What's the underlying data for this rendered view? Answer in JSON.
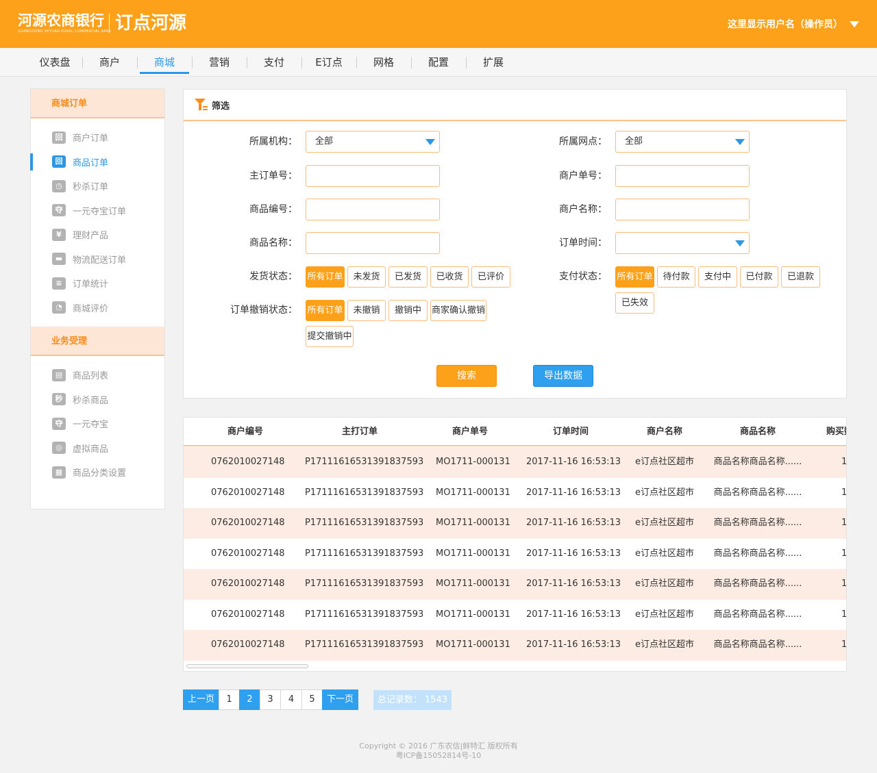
{
  "header": {
    "logo_main": "河源农商银行",
    "logo_sub": "GUANGDONG HEYUAN RURAL COMMERCIAL BANK",
    "app_name": "订点河源",
    "user_label": "这里显示用户名（操作员）"
  },
  "nav": [
    "仪表盘",
    "商户",
    "商城",
    "营销",
    "支付",
    "E订点",
    "网格",
    "配置",
    "扩展"
  ],
  "sidebar": {
    "group1_title": "商城订单",
    "group1_items": [
      {
        "label": "商户订单",
        "icon": "回"
      },
      {
        "label": "商品订单",
        "icon": "回"
      },
      {
        "label": "秒杀订单",
        "icon": "◷"
      },
      {
        "label": "一元夺宝订单",
        "icon": "夺"
      },
      {
        "label": "理财产品",
        "icon": "¥"
      },
      {
        "label": "物流配送订单",
        "icon": "▬"
      },
      {
        "label": "订单统计",
        "icon": "≡"
      },
      {
        "label": "商城评价",
        "icon": "◔"
      }
    ],
    "group2_title": "业务受理",
    "group2_items": [
      {
        "label": "商品列表",
        "icon": "▤"
      },
      {
        "label": "秒杀商品",
        "icon": "秒"
      },
      {
        "label": "一元夺宝",
        "icon": "夺"
      },
      {
        "label": "虚拟商品",
        "icon": "◎"
      },
      {
        "label": "商品分类设置",
        "icon": "▦"
      }
    ]
  },
  "filter": {
    "title": "筛选",
    "org_label": "所属机构：",
    "org_value": "全部",
    "branch_label": "所属网点：",
    "branch_value": "全部",
    "main_order_label": "主订单号：",
    "merchant_order_label": "商户单号：",
    "product_code_label": "商品编号：",
    "merchant_name_label": "商户名称：",
    "product_name_label": "商品名称：",
    "order_time_label": "订单时间：",
    "ship_label": "发货状态：",
    "ship_options": [
      "所有订单",
      "未发货",
      "已发货",
      "已收货",
      "已评价"
    ],
    "pay_label": "支付状态：",
    "pay_options": [
      "所有订单",
      "待付款",
      "支付中",
      "已付款",
      "已退款",
      "已失效"
    ],
    "cancel_label": "订单撤销状态：",
    "cancel_options": [
      "所有订单",
      "未撤销",
      "撤销中",
      "商家确认撤销",
      "提交撤销中"
    ],
    "search_button": "搜索",
    "export_button": "导出数据"
  },
  "table": {
    "columns": [
      "商户编号",
      "主打订单",
      "商户单号",
      "订单时间",
      "商户名称",
      "商品名称",
      "购买数"
    ],
    "rows": [
      [
        "0762010027148",
        "P17111616531391837593",
        "MO1711-000131",
        "2017-11-16 16:53:13",
        "e订点社区超市",
        "商品名称商品名称......",
        "1"
      ],
      [
        "0762010027148",
        "P17111616531391837593",
        "MO1711-000131",
        "2017-11-16 16:53:13",
        "e订点社区超市",
        "商品名称商品名称......",
        "1"
      ],
      [
        "0762010027148",
        "P17111616531391837593",
        "MO1711-000131",
        "2017-11-16 16:53:13",
        "e订点社区超市",
        "商品名称商品名称......",
        "1"
      ],
      [
        "0762010027148",
        "P17111616531391837593",
        "MO1711-000131",
        "2017-11-16 16:53:13",
        "e订点社区超市",
        "商品名称商品名称......",
        "1"
      ],
      [
        "0762010027148",
        "P17111616531391837593",
        "MO1711-000131",
        "2017-11-16 16:53:13",
        "e订点社区超市",
        "商品名称商品名称......",
        "1"
      ],
      [
        "0762010027148",
        "P17111616531391837593",
        "MO1711-000131",
        "2017-11-16 16:53:13",
        "e订点社区超市",
        "商品名称商品名称......",
        "1"
      ],
      [
        "0762010027148",
        "P17111616531391837593",
        "MO1711-000131",
        "2017-11-16 16:53:13",
        "e订点社区超市",
        "商品名称商品名称......",
        "1"
      ]
    ]
  },
  "pagination": {
    "prev": "上一页",
    "pages": [
      "1",
      "2",
      "3",
      "4",
      "5"
    ],
    "next": "下一页",
    "total": "总记录数： 1543"
  },
  "footer": {
    "line1": "Copyright © 2016 广东农信|鲜特汇 版权所有",
    "line2": "粤ICP备15052814号-10"
  },
  "colors": {
    "brand_orange": "#fea11a",
    "accent_blue": "#2d97e6",
    "row_tint": "#fdece3"
  }
}
